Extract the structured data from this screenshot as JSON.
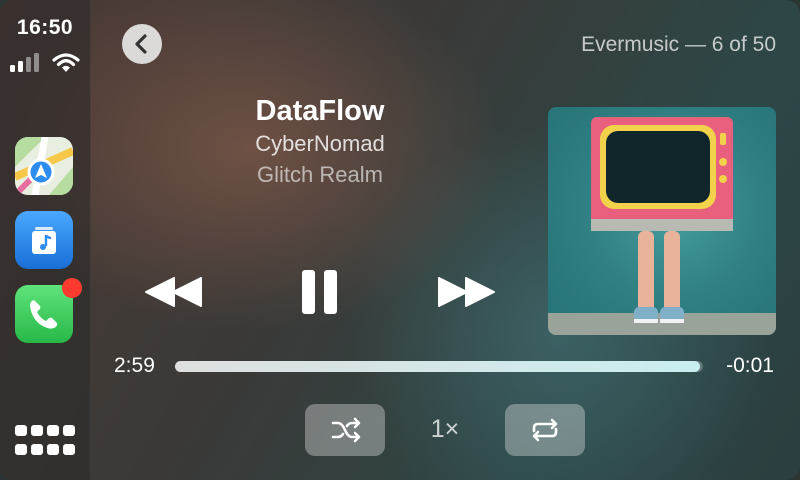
{
  "status_bar": {
    "time": "16:50"
  },
  "sidebar": {
    "apps": [
      {
        "name": "Maps",
        "icon": "maps-icon"
      },
      {
        "name": "Music",
        "icon": "music-icon"
      },
      {
        "name": "Phone",
        "icon": "phone-icon",
        "badge": true
      }
    ],
    "home_icon": "app-grid-icon"
  },
  "header": {
    "source": "Evermusic — 6 of 50"
  },
  "track": {
    "title": "DataFlow",
    "artist": "CyberNomad",
    "album": "Glitch Realm"
  },
  "playback": {
    "elapsed": "2:59",
    "remaining": "-0:01",
    "progress_fraction": 0.995,
    "speed": "1×",
    "state": "playing"
  },
  "colors": {
    "accent_progress": "#c9eef0",
    "badge": "#ff3b30",
    "phone_green": "#34c759",
    "music_blue": "#2d8cf0"
  }
}
